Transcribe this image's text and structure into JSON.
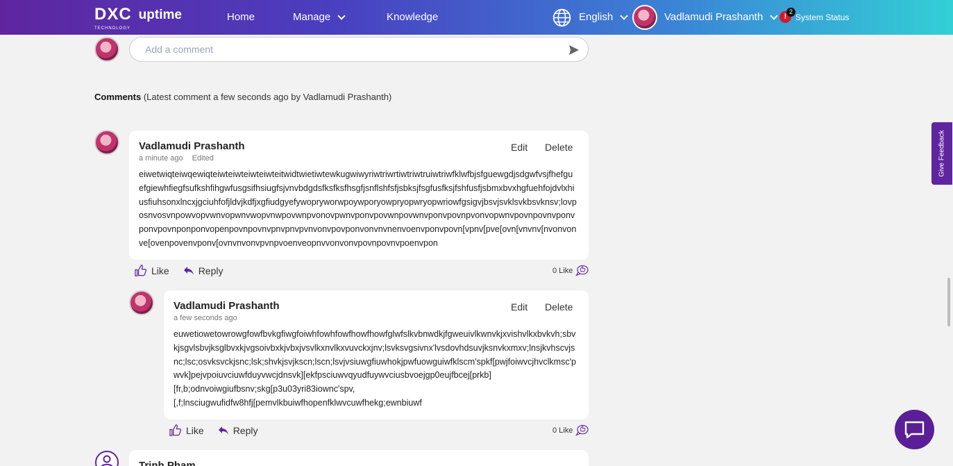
{
  "header": {
    "logo_dxc": "DXC",
    "logo_tech": "TECHNOLOGY",
    "logo_uptime": "uptime",
    "nav": {
      "home": "Home",
      "manage": "Manage",
      "knowledge": "Knowledge"
    },
    "language": "English",
    "user_name": "Vadlamudi Prashanth",
    "alert_count": "2",
    "alert_symbol": "!",
    "system_status": "System Status"
  },
  "comment_box": {
    "placeholder": "Add a comment"
  },
  "comments_heading": {
    "label": "Comments",
    "detail": "(Latest comment a few seconds ago by Vadlamudi Prashanth)"
  },
  "comments": [
    {
      "author": "Vadlamudi Prashanth",
      "time": "a minute ago",
      "edited": "Edited",
      "edit_label": "Edit",
      "delete_label": "Delete",
      "text": "eiwetwiqteiwqewiqteiwteiwteiwteiwteitwidtwietiwtewkugwiwyriwtriwrtiwtriwtruiwtriwfklwfbjsfguewgdjsdgwfvsjfhefguefgiewhfiegfsufkshfihgwfusgsifhsiugfsjvnvbdgdsfksfksfhsgfjsnflshfsfjsbksjfsgfusfksjfshfusfjsbmxbvxhgfuehfojdvlxhiusfiuhsonxlncxjgciuhfofjldvjkdfjxgfiudgyefywopryworwpoywporyowpryopwryopwriowfgsigvjbsvjsvklsvkbsvknsv;lovposnvosvnpowvopvwnvopwnvwopvnwpovwnpvonovpwnvponvpovwnpovwnvponvpovnpvonvopwnvpovnpovnvponvponvpovnponponvopenpovnpovnvpnvpnvpvnvonvpovponvonvnvnenvoenvponvpovn[vpnv[pve[ovn[vnvnv[nvonvonve[ovenpovenvponv[ovnvnvonvpvnpvoenveopnvvonvonvpovnpovnvpoenvpon",
      "like_label": "Like",
      "reply_label": "Reply",
      "like_count": "0 Like"
    },
    {
      "author": "Vadlamudi Prashanth",
      "time": "a few seconds ago",
      "edit_label": "Edit",
      "delete_label": "Delete",
      "text": "euwetiowetowrowgfowfbvkgfiwgfoiwhfowhfowfhowfhowfglwfslkvbnwdkjfgweuivlkwnvkjxvishvlkxbvkvh;sbvkjsgvlsbvjksglbvxkjvgsoivbxkjvbxjvsvlkxnvlkxvuvckxjnv;lsvksvgsivnx'lvsdovhdsuvjksnvkxmxv;lnsjkvhscvjsnc;lsc;osvksvckjsnc;lsk;shvkjsvjkscn;lscn;lsvjvsiuwgfiuwhokjpwfuowguiwfklscm'spkf[pwjfoiwvcjhvclkmsc'pwvk]pejvpoiuvciuwfduyvwcjdnsvk][ekfpsciuwvqyudfuywvciusbvoejgp0eujfbcej[prkb]\n[fr,b;odnvoiwgiufbsnv;skg[p3u03yri83iownc'spv,\n[,f;lnsciugwufidfw8hfj[pemvlkbuiwfhopenfklwvcuwfhekg;ewnbiuwf",
      "like_label": "Like",
      "reply_label": "Reply",
      "like_count": "0 Like"
    },
    {
      "author": "Trinh Pham"
    }
  ],
  "feedback_tab": "Give Feedback",
  "colors": {
    "brand_purple": "#5f259f",
    "header_end": "#33cfd6",
    "alert_red": "#d01b2f"
  }
}
